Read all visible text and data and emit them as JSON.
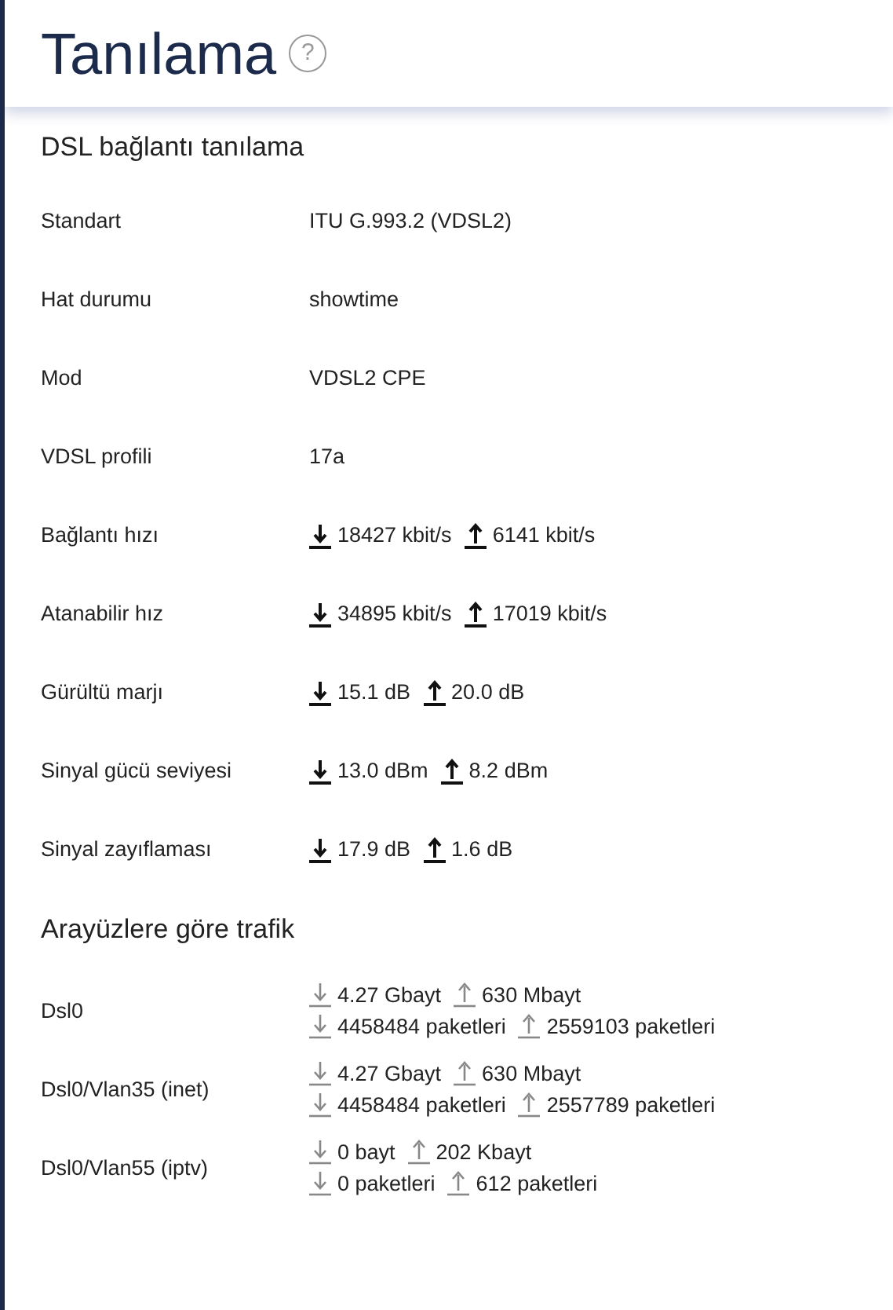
{
  "header": {
    "title": "Tanılama",
    "help_glyph": "?"
  },
  "dsl": {
    "heading": "DSL bağlantı tanılama",
    "rows": [
      {
        "kind": "text",
        "label": "Standart",
        "value": "ITU G.993.2 (VDSL2)"
      },
      {
        "kind": "text",
        "label": "Hat durumu",
        "value": "showtime"
      },
      {
        "kind": "text",
        "label": "Mod",
        "value": "VDSL2 CPE"
      },
      {
        "kind": "text",
        "label": "VDSL profili",
        "value": "17a"
      },
      {
        "kind": "updown",
        "label": "Bağlantı hızı",
        "down": "18427 kbit/s",
        "up": "6141 kbit/s"
      },
      {
        "kind": "updown",
        "label": "Atanabilir hız",
        "down": "34895 kbit/s",
        "up": "17019 kbit/s"
      },
      {
        "kind": "updown",
        "label": "Gürültü marjı",
        "down": "15.1 dB",
        "up": "20.0 dB"
      },
      {
        "kind": "updown",
        "label": "Sinyal gücü seviyesi",
        "down": "13.0 dBm",
        "up": "8.2 dBm"
      },
      {
        "kind": "updown",
        "label": "Sinyal zayıflaması",
        "down": "17.9 dB",
        "up": "1.6 dB"
      }
    ]
  },
  "traffic": {
    "heading": "Arayüzlere göre trafik",
    "rows": [
      {
        "label": "Dsl0",
        "lines": [
          {
            "down": "4.27 Gbayt",
            "up": "630 Mbayt"
          },
          {
            "down": "4458484 paketleri",
            "up": "2559103 paketleri"
          }
        ]
      },
      {
        "label": "Dsl0/Vlan35 (inet)",
        "lines": [
          {
            "down": "4.27 Gbayt",
            "up": "630 Mbayt"
          },
          {
            "down": "4458484 paketleri",
            "up": "2557789 paketleri"
          }
        ]
      },
      {
        "label": "Dsl0/Vlan55 (iptv)",
        "lines": [
          {
            "down": "0 bayt",
            "up": "202 Kbayt"
          },
          {
            "down": "0 paketleri",
            "up": "612 paketleri"
          }
        ]
      }
    ]
  }
}
